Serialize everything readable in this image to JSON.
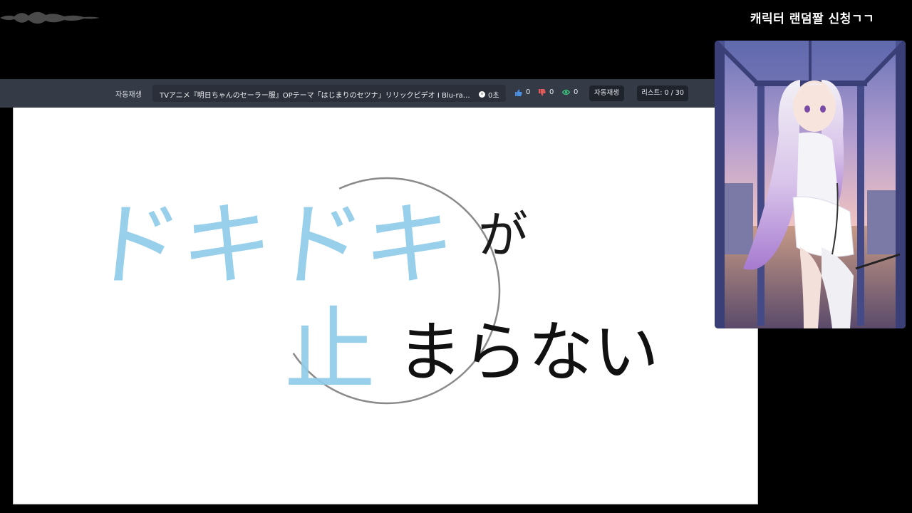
{
  "side_title": "캐릭터 랜덤짤 신청ㄱㄱ",
  "player_bar": {
    "autoplay_label": "자동재생",
    "video_title": "TVアニメ『明日ちゃんのセーラー服』OPテーマ「はじまりのセツナ」リリックビデオ I Blu-ray&DVD 4.27 0…",
    "time": "0초",
    "likes": "0",
    "dislikes": "0",
    "views": "0",
    "autoplay_button": "자동재생",
    "list_button": "리스트: 0 / 30"
  },
  "lyric": {
    "line1_blue": "ドキドキ",
    "line1_black": "が",
    "line2_blue": "止",
    "line2_black": "まらない"
  },
  "colors": {
    "bar": "#343a46",
    "lyric_blue": "#8fcbe8",
    "like": "#4a90e2",
    "dislike": "#e05a5a",
    "view": "#3cbf7a"
  },
  "icons": [
    "thumbs-up-icon",
    "thumbs-down-icon",
    "eye-icon",
    "clock-icon"
  ]
}
